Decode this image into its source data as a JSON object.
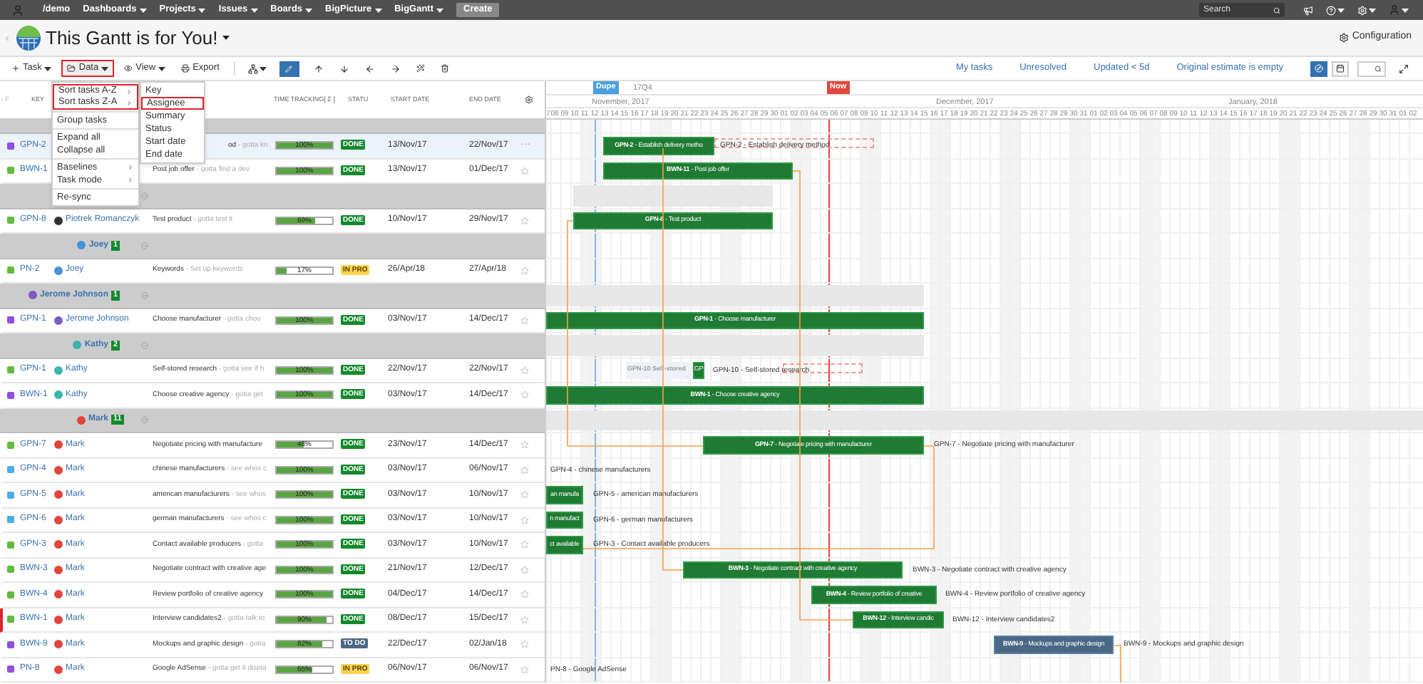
{
  "nav": {
    "home": "/demo",
    "menus": [
      "Dashboards",
      "Projects",
      "Issues",
      "Boards",
      "BigPicture",
      "BigGantt"
    ],
    "create": "Create",
    "search": {
      "placeholder": "Search"
    }
  },
  "header": {
    "title": "This Gantt is for You!",
    "configuration": "Configuration"
  },
  "toolbar": {
    "items": [
      {
        "kind": "task",
        "label": "Task",
        "highlighted": false
      },
      {
        "kind": "data",
        "label": "Data",
        "highlighted": true
      },
      {
        "kind": "view",
        "label": "View",
        "highlighted": false
      },
      {
        "kind": "export",
        "label": "Export",
        "highlighted": false
      }
    ],
    "filters": [
      "My tasks",
      "Unresolved",
      "Updated < 5d",
      "Original estimate is empty"
    ]
  },
  "menu": {
    "items": [
      {
        "kind": "item",
        "label": "Sort tasks A-Z",
        "submenu": true,
        "highlighted": true
      },
      {
        "kind": "item",
        "label": "Sort tasks Z-A",
        "submenu": true,
        "highlighted": true
      },
      {
        "kind": "divider"
      },
      {
        "kind": "item",
        "label": "Group tasks",
        "submenu": false,
        "highlighted": false
      },
      {
        "kind": "divider"
      },
      {
        "kind": "item",
        "label": "Expand all",
        "submenu": false,
        "highlighted": false
      },
      {
        "kind": "item",
        "label": "Collapse all",
        "submenu": false,
        "highlighted": false
      },
      {
        "kind": "divider"
      },
      {
        "kind": "item",
        "label": "Baselines",
        "submenu": true,
        "highlighted": false
      },
      {
        "kind": "item",
        "label": "Task mode",
        "submenu": true,
        "highlighted": false
      },
      {
        "kind": "divider"
      },
      {
        "kind": "item",
        "label": "Re-sync",
        "submenu": false,
        "highlighted": false
      }
    ],
    "submenu": [
      {
        "label": "Key",
        "selected": false
      },
      {
        "label": "Assignee",
        "selected": true
      },
      {
        "label": "Summary",
        "selected": false
      },
      {
        "label": "Status",
        "selected": false
      },
      {
        "label": "Start date",
        "selected": false
      },
      {
        "label": "End date",
        "selected": false
      }
    ]
  },
  "table": {
    "columns": [
      "‹ F",
      "KEY",
      "TIME TRACKING[ Σ ]",
      "STATU",
      "START DATE",
      "END DATE"
    ],
    "rows": [
      {
        "kind": "group"
      },
      {
        "kind": "task",
        "type": {
          "color": "#904ee2"
        },
        "key": "GPN-2",
        "summary": "od",
        "description": "- gotta kn",
        "tracking": "100%",
        "level": 1,
        "status": {
          "text": "DONE",
          "kind": "done"
        },
        "start": "13/Nov/17",
        "end": "22/Nov/17",
        "selected": true,
        "flagged": false,
        "more": "···",
        "gantt": [
          {
            "kind": "bar",
            "text": "**GPN-2** - Establish delivery metho"
          },
          {
            "kind": "baseline"
          },
          {
            "kind": "note",
            "text": "GPN-2 - Establish delivery method"
          }
        ]
      },
      {
        "kind": "task",
        "type": {
          "color": "#63ba3c"
        },
        "key": "BWN-1",
        "summary": "Post job offer",
        "description": "- gotta find a dev",
        "tracking": "100%",
        "level": 1,
        "status": {
          "text": "DONE",
          "kind": "done"
        },
        "start": "13/Nov/17",
        "end": "01/Dec/17",
        "selected": false,
        "flagged": false,
        "gantt": [
          {
            "kind": "bar",
            "text": "**BWN-11** - Post job offer"
          }
        ]
      },
      {
        "kind": "group",
        "expanded": true,
        "gantt": [
          {
            "kind": "summary"
          }
        ]
      },
      {
        "kind": "task",
        "type": {
          "color": "#63ba3c"
        },
        "key": "GPN-8",
        "assignee": "Piotrek Romanczyk",
        "avatar": {
          "color": "#333333"
        },
        "summary": "Test product",
        "description": "- gotta test it",
        "tracking": "69%",
        "level": 0.69,
        "status": {
          "text": "DONE",
          "kind": "done"
        },
        "start": "10/Nov/17",
        "end": "29/Nov/17",
        "selected": false,
        "flagged": false,
        "gantt": [
          {
            "kind": "bar",
            "text": "**GPN-8** - Test product"
          }
        ]
      },
      {
        "kind": "group",
        "name": "Joey",
        "count": "1",
        "avatar": {
          "color": "#4a90d9"
        },
        "expanded": true
      },
      {
        "kind": "task",
        "type": {
          "color": "#63ba3c"
        },
        "key": "PN-2",
        "assignee": "Joey",
        "avatar": {
          "color": "#4a90d9"
        },
        "summary": "Keywords",
        "description": "- Set up keywords",
        "tracking": "17%",
        "level": 0.17,
        "status": {
          "text": "IN PRO",
          "kind": "inprogress"
        },
        "start": "26/Apr/18",
        "end": "27/Apr/18",
        "selected": false,
        "flagged": false
      },
      {
        "kind": "group",
        "name": "Jerome Johnson",
        "count": "1",
        "avatar": {
          "color": "#7b5cc4"
        },
        "expanded": true,
        "gantt": [
          {
            "kind": "summary"
          }
        ]
      },
      {
        "kind": "task",
        "type": {
          "color": "#904ee2"
        },
        "key": "GPN-1",
        "assignee": "Jerome Johnson",
        "avatar": {
          "color": "#7b5cc4"
        },
        "summary": "Choose manufacturer",
        "description": "- gotta choo",
        "tracking": "100%",
        "level": 1,
        "status": {
          "text": "DONE",
          "kind": "done"
        },
        "start": "03/Nov/17",
        "end": "14/Dec/17",
        "selected": false,
        "flagged": false,
        "gantt": [
          {
            "kind": "bar",
            "text": "**GPN-1** - Choose manufacturer"
          }
        ]
      },
      {
        "kind": "group",
        "name": "Kathy",
        "count": "2",
        "avatar": {
          "color": "#3bb4b0"
        },
        "expanded": true,
        "gantt": [
          {
            "kind": "summary"
          }
        ]
      },
      {
        "kind": "task",
        "type": {
          "color": "#63ba3c"
        },
        "key": "GPN-1",
        "assignee": "Kathy",
        "avatar": {
          "color": "#3bb4b0"
        },
        "summary": "Self-stored research",
        "description": "- gotta see if h",
        "tracking": "100%",
        "level": 1,
        "status": {
          "text": "DONE",
          "kind": "done"
        },
        "start": "22/Nov/17",
        "end": "22/Nov/17",
        "selected": false,
        "flagged": false,
        "gantt": [
          {
            "kind": "ghost",
            "text": "GPN-10 Self-stored"
          },
          {
            "kind": "bar",
            "text": "GP"
          },
          {
            "kind": "note",
            "text": "GPN-10 - Self-stored research"
          },
          {
            "kind": "baseline"
          }
        ]
      },
      {
        "kind": "task",
        "type": {
          "color": "#904ee2"
        },
        "key": "BWN-1",
        "assignee": "Kathy",
        "avatar": {
          "color": "#3bb4b0"
        },
        "summary": "Choose creative agency",
        "description": "- gotta get",
        "tracking": "100%",
        "level": 1,
        "status": {
          "text": "DONE",
          "kind": "done"
        },
        "start": "03/Nov/17",
        "end": "14/Dec/17",
        "selected": false,
        "flagged": false,
        "gantt": [
          {
            "kind": "bar",
            "text": "**BWN-1** - Choose creative agency"
          }
        ]
      },
      {
        "kind": "group",
        "name": "Mark",
        "count": "11",
        "avatar": {
          "color": "#e0463c"
        },
        "expanded": true,
        "gantt": [
          {
            "kind": "summary"
          }
        ]
      },
      {
        "kind": "task",
        "type": {
          "color": "#63ba3c"
        },
        "key": "GPN-7",
        "assignee": "Mark",
        "avatar": {
          "color": "#e0463c"
        },
        "summary": "Negotiate pricing with manufacture",
        "tracking": "48%",
        "level": 0.48,
        "status": {
          "text": "DONE",
          "kind": "done"
        },
        "start": "23/Nov/17",
        "end": "14/Dec/17",
        "selected": false,
        "flagged": false,
        "gantt": [
          {
            "kind": "bar",
            "text": "**GPN-7** - Negotiate pricing with manufacturer"
          },
          {
            "kind": "note",
            "text": "GPN-7 - Negotiate pricing with manufacturer"
          }
        ]
      },
      {
        "kind": "task",
        "type": {
          "color": "#4bade8"
        },
        "key": "GPN-4",
        "assignee": "Mark",
        "avatar": {
          "color": "#e0463c"
        },
        "summary": "chinese manufacturers",
        "description": "- see whos c",
        "tracking": "100%",
        "level": 1,
        "status": {
          "text": "DONE",
          "kind": "done"
        },
        "start": "03/Nov/17",
        "end": "06/Nov/17",
        "selected": false,
        "flagged": false,
        "gantt": [
          {
            "kind": "note",
            "text": "GPN-4 - chinese manufacturers"
          }
        ]
      },
      {
        "kind": "task",
        "type": {
          "color": "#4bade8"
        },
        "key": "GPN-5",
        "assignee": "Mark",
        "avatar": {
          "color": "#e0463c"
        },
        "summary": "american manufacturers",
        "description": "- see whos",
        "tracking": "100%",
        "level": 1,
        "status": {
          "text": "DONE",
          "kind": "done"
        },
        "start": "03/Nov/17",
        "end": "10/Nov/17",
        "selected": false,
        "flagged": false,
        "gantt": [
          {
            "kind": "bar",
            "text": "an manufa"
          },
          {
            "kind": "note",
            "text": "GPN-5 - american manufacturers"
          }
        ]
      },
      {
        "kind": "task",
        "type": {
          "color": "#4bade8"
        },
        "key": "GPN-6",
        "assignee": "Mark",
        "avatar": {
          "color": "#e0463c"
        },
        "summary": "german manufacturers",
        "description": "- see whos c",
        "tracking": "100%",
        "level": 1,
        "status": {
          "text": "DONE",
          "kind": "done"
        },
        "start": "03/Nov/17",
        "end": "10/Nov/17",
        "selected": false,
        "flagged": false,
        "gantt": [
          {
            "kind": "bar",
            "text": "n manufact"
          },
          {
            "kind": "note",
            "text": "GPN-6 - german manufacturers"
          }
        ]
      },
      {
        "kind": "task",
        "type": {
          "color": "#63ba3c"
        },
        "key": "GPN-3",
        "assignee": "Mark",
        "avatar": {
          "color": "#e0463c"
        },
        "summary": "Contact available producers",
        "description": "- gotta",
        "tracking": "100%",
        "level": 1,
        "status": {
          "text": "DONE",
          "kind": "done"
        },
        "start": "03/Nov/17",
        "end": "10/Nov/17",
        "selected": false,
        "flagged": false,
        "gantt": [
          {
            "kind": "bar",
            "text": "ct available"
          },
          {
            "kind": "note",
            "text": "GPN-3 - Contact available producers"
          }
        ]
      },
      {
        "kind": "task",
        "type": {
          "color": "#63ba3c"
        },
        "key": "BWN-3",
        "assignee": "Mark",
        "avatar": {
          "color": "#e0463c"
        },
        "summary": "Negotiate contract with creative age",
        "tracking": "100%",
        "level": 1,
        "status": {
          "text": "DONE",
          "kind": "done"
        },
        "start": "21/Nov/17",
        "end": "12/Dec/17",
        "selected": false,
        "flagged": false,
        "gantt": [
          {
            "kind": "bar",
            "text": "**BWN-3** - Negotiate contract with creative agency"
          },
          {
            "kind": "note",
            "text": "BWN-3 - Negotiate contract with creative agency"
          }
        ]
      },
      {
        "kind": "task",
        "type": {
          "color": "#63ba3c"
        },
        "key": "BWN-4",
        "assignee": "Mark",
        "avatar": {
          "color": "#e0463c"
        },
        "summary": "Review portfolio of creative agency",
        "tracking": "100%",
        "level": 1,
        "status": {
          "text": "DONE",
          "kind": "done"
        },
        "start": "04/Dec/17",
        "end": "14/Dec/17",
        "selected": false,
        "flagged": false,
        "gantt": [
          {
            "kind": "bar",
            "text": "**BWN-4** - Review portfolio of creative"
          },
          {
            "kind": "note",
            "text": "BWN-4 - Review portfolio of creative agency"
          }
        ]
      },
      {
        "kind": "task",
        "type": {
          "color": "#63ba3c"
        },
        "key": "BWN-1",
        "assignee": "Mark",
        "avatar": {
          "color": "#e0463c"
        },
        "summary": "Interview candidates2",
        "description": "- gotta talk to",
        "tracking": "90%",
        "level": 0.9,
        "status": {
          "text": "DONE",
          "kind": "done"
        },
        "start": "08/Dec/17",
        "end": "15/Dec/17",
        "selected": false,
        "flagged": true,
        "gantt": [
          {
            "kind": "bar",
            "text": "**BWN-12** - Interview candic"
          },
          {
            "kind": "note",
            "text": "BWN-12 - Interview candidates2"
          }
        ]
      },
      {
        "kind": "task",
        "type": {
          "color": "#904ee2"
        },
        "key": "BWN-9",
        "assignee": "Mark",
        "avatar": {
          "color": "#e0463c"
        },
        "summary": "Mockups and graphic design",
        "description": "- gotta",
        "tracking": "82%",
        "level": 0.82,
        "status": {
          "text": "TO DO",
          "kind": "todo"
        },
        "start": "22/Dec/17",
        "end": "02/Jan/18",
        "selected": false,
        "flagged": false,
        "gantt": [
          {
            "kind": "planned",
            "text": "**BWN-9** - Mockups and graphic design"
          },
          {
            "kind": "note",
            "text": "BWN-9 - Mockups and graphic design"
          }
        ]
      },
      {
        "kind": "task",
        "type": {
          "color": "#904ee2"
        },
        "key": "PN-8",
        "assignee": "Mark",
        "avatar": {
          "color": "#e0463c"
        },
        "summary": "Google AdSense",
        "description": "- gotta get it displa",
        "tracking": "65%",
        "level": 0.65,
        "status": {
          "text": "IN PRO",
          "kind": "inprogress"
        },
        "start": "06/Nov/17",
        "end": "06/Nov/17",
        "selected": false,
        "flagged": false,
        "gantt": [
          {
            "kind": "note",
            "text": "PN-8 - Google AdSense"
          }
        ]
      }
    ]
  },
  "timeline": {
    "quarter": "17Q4",
    "markers": [
      {
        "kind": "dupe",
        "label": "Dupe"
      },
      {
        "kind": "now",
        "label": "Now"
      }
    ],
    "months": [
      "November, 2017",
      "December, 2017",
      "January, 2018"
    ],
    "days": [
      "7",
      "08",
      "09",
      "10",
      "11",
      "12",
      "13",
      "14",
      "15",
      "16",
      "17",
      "18",
      "19",
      "20",
      "21",
      "22",
      "23",
      "24",
      "25",
      "26",
      "27",
      "28",
      "29",
      "30",
      "01",
      "02",
      "03",
      "04",
      "05",
      "06",
      "07",
      "08",
      "09",
      "10",
      "11",
      "12",
      "13",
      "14",
      "15",
      "16",
      "17",
      "18",
      "19",
      "20",
      "21",
      "22",
      "23",
      "24",
      "25",
      "26",
      "27",
      "28",
      "29",
      "30",
      "31",
      "01",
      "02",
      "03",
      "04",
      "05",
      "06",
      "07",
      "08",
      "09",
      "10",
      "11",
      "12",
      "13",
      "14",
      "15",
      "16",
      "17",
      "18",
      "19",
      "20",
      "21",
      "22",
      "23",
      "24",
      "25",
      "26",
      "27",
      "28",
      "29",
      "30",
      "31",
      "01",
      "02"
    ]
  }
}
